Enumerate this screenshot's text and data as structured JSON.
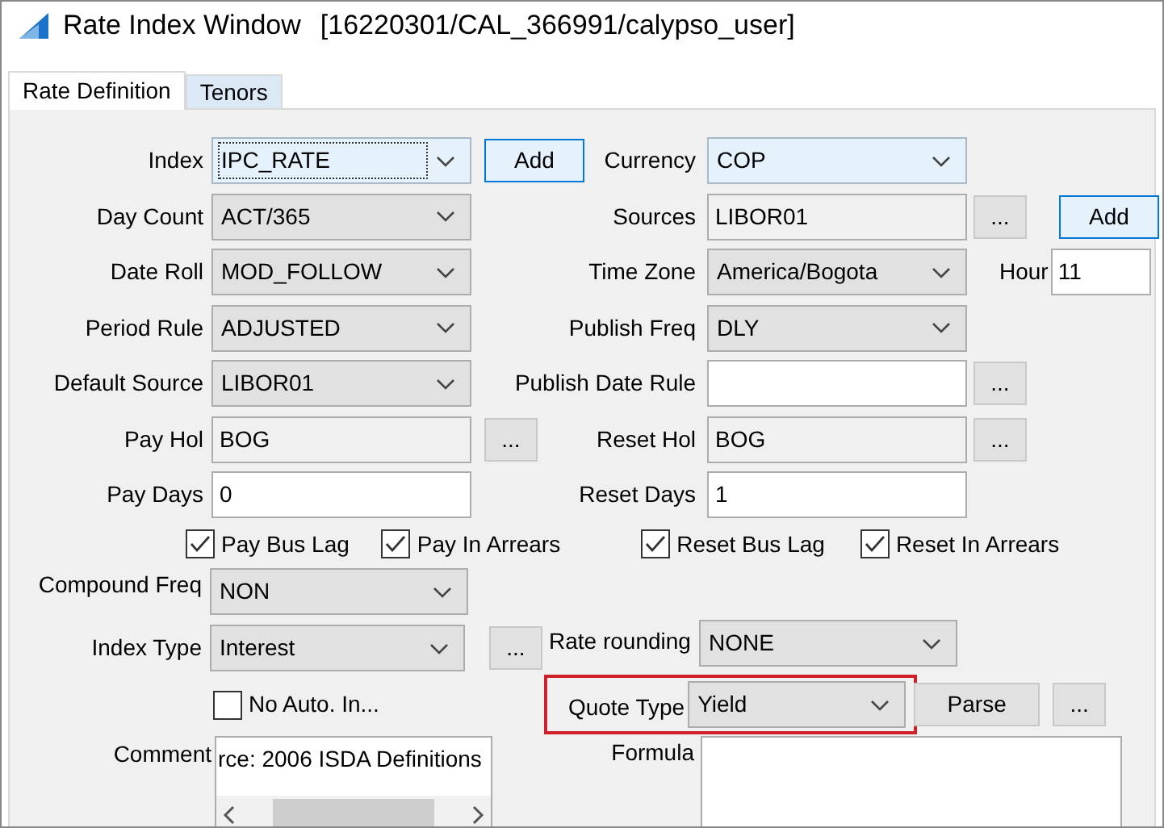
{
  "window": {
    "title": "Rate Index Window",
    "context": "[16220301/CAL_366991/calypso_user]"
  },
  "tabs": [
    {
      "label": "Rate Definition",
      "selected": true
    },
    {
      "label": "Tenors",
      "selected": false
    }
  ],
  "rows": [
    {
      "left": {
        "label": "Index",
        "kind": "combo",
        "value": "IPC_RATE",
        "highlighted": true,
        "focused": true
      },
      "left_button": {
        "label": "Add",
        "highlighted": true
      },
      "right": {
        "label": "Currency",
        "kind": "combo",
        "value": "COP",
        "highlighted": true,
        "focused": false
      }
    },
    {
      "left": {
        "label": "Day Count",
        "kind": "combo",
        "value": "ACT/365",
        "highlighted": false,
        "focused": false
      },
      "right": {
        "label": "Sources",
        "kind": "text",
        "value": "LIBOR01",
        "editable": false
      },
      "right_button": {
        "label": "...",
        "highlighted": false
      },
      "extra_button": {
        "label": "Add",
        "highlighted": true
      }
    },
    {
      "left": {
        "label": "Date Roll",
        "kind": "combo",
        "value": "MOD_FOLLOW",
        "highlighted": false,
        "focused": false
      },
      "right": {
        "label": "Time Zone",
        "kind": "combo",
        "value": "America/Bogota",
        "highlighted": false,
        "focused": false
      },
      "extra_field": {
        "label": "Hour",
        "value": "11"
      }
    },
    {
      "left": {
        "label": "Period Rule",
        "kind": "combo",
        "value": "ADJUSTED",
        "highlighted": false,
        "focused": false
      },
      "right": {
        "label": "Publish Freq",
        "kind": "combo",
        "value": "DLY",
        "highlighted": false,
        "focused": false
      }
    },
    {
      "left": {
        "label": "Default Source",
        "kind": "combo",
        "value": "LIBOR01",
        "highlighted": false,
        "focused": false
      },
      "right": {
        "label": "Publish Date Rule",
        "kind": "text",
        "editable": true
      },
      "right_button": {
        "label": "...",
        "highlighted": false
      }
    },
    {
      "left": {
        "label": "Pay Hol",
        "kind": "text",
        "value": "BOG",
        "editable": false
      },
      "left_button": {
        "label": "...",
        "highlighted": false
      },
      "right": {
        "label": "Reset Hol",
        "kind": "text",
        "value": "BOG",
        "editable": false
      },
      "right_button": {
        "label": "...",
        "highlighted": false
      }
    },
    {
      "left": {
        "label": "Pay Days",
        "kind": "text",
        "value": "0",
        "editable": true
      },
      "right": {
        "label": "Reset Days",
        "kind": "text",
        "value": "1",
        "editable": true
      }
    }
  ],
  "checkboxes": [
    {
      "label": "Pay Bus Lag",
      "checked": true
    },
    {
      "label": "Pay In Arrears",
      "checked": true
    },
    {
      "label": "Reset Bus Lag",
      "checked": true
    },
    {
      "label": "Reset In Arrears",
      "checked": true
    }
  ],
  "compound_freq": {
    "label": "Compound Freq",
    "value": "NON"
  },
  "index_type": {
    "label": "Index Type",
    "value": "Interest",
    "button": "..."
  },
  "rate_rounding": {
    "label": "Rate rounding",
    "value": "NONE"
  },
  "no_auto": {
    "label": "No Auto. In...",
    "checked": false
  },
  "quote_type": {
    "label": "Quote Type",
    "value": "Yield",
    "outlined": true,
    "parse_button": "Parse",
    "more_button": "..."
  },
  "comment": {
    "label": "Comment",
    "value": "rce: 2006 ISDA Definitions"
  },
  "formula": {
    "label": "Formula"
  }
}
